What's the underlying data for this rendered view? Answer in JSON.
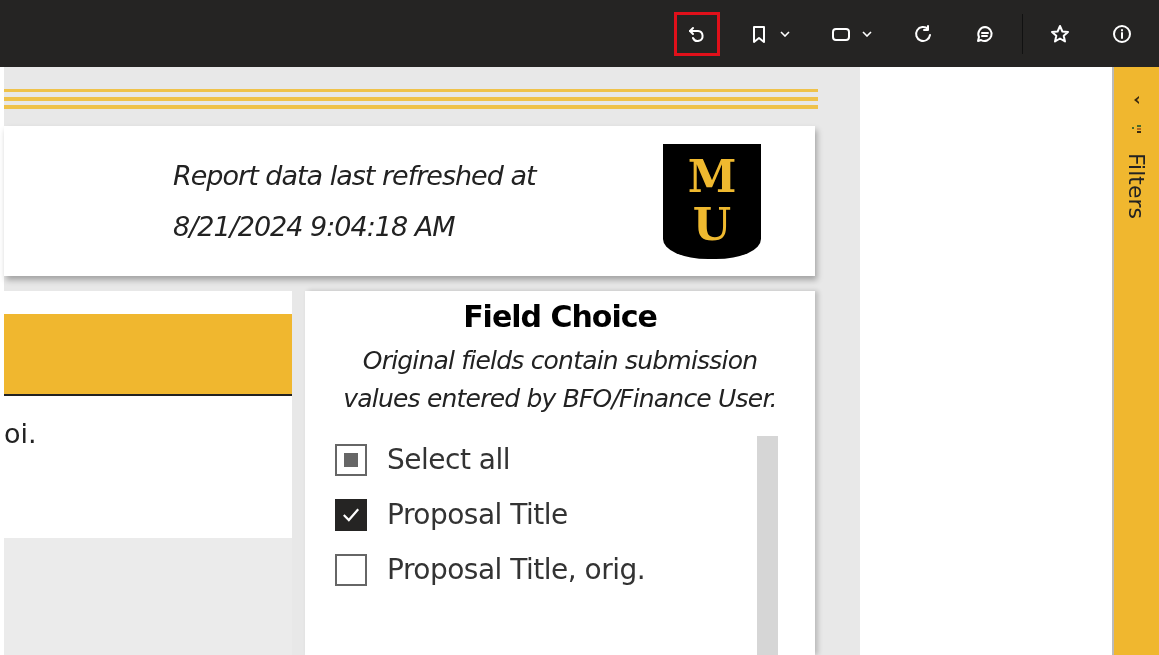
{
  "toolbar": [
    {
      "kind": "undo",
      "highlighted": true,
      "dropdown": false
    },
    {
      "kind": "bookmark",
      "highlighted": false,
      "dropdown": true
    },
    {
      "kind": "view",
      "highlighted": false,
      "dropdown": true
    },
    {
      "kind": "refresh",
      "highlighted": false,
      "dropdown": false
    },
    {
      "kind": "comment",
      "highlighted": false,
      "dropdown": false
    },
    {
      "kind": "star",
      "highlighted": false,
      "dropdown": false
    },
    {
      "kind": "info",
      "highlighted": false,
      "dropdown": false
    }
  ],
  "report_header": {
    "refresh_label": "Report data last refreshed at",
    "refresh_time": "8/21/2024 9:04:18 AM",
    "logo": {
      "letters": [
        "M",
        "U"
      ]
    }
  },
  "left_visual": {
    "text": "oi."
  },
  "field_choice": {
    "title": "Field Choice",
    "description": "Original fields contain submission values entered by BFO/Finance User.",
    "items": [
      {
        "label": "Select all",
        "checked": false,
        "partial": true
      },
      {
        "label": "Proposal Title",
        "checked": true,
        "partial": false
      },
      {
        "label": "Proposal Title, orig.",
        "checked": false,
        "partial": false
      }
    ]
  },
  "filters_pane": {
    "label": "Filters"
  }
}
